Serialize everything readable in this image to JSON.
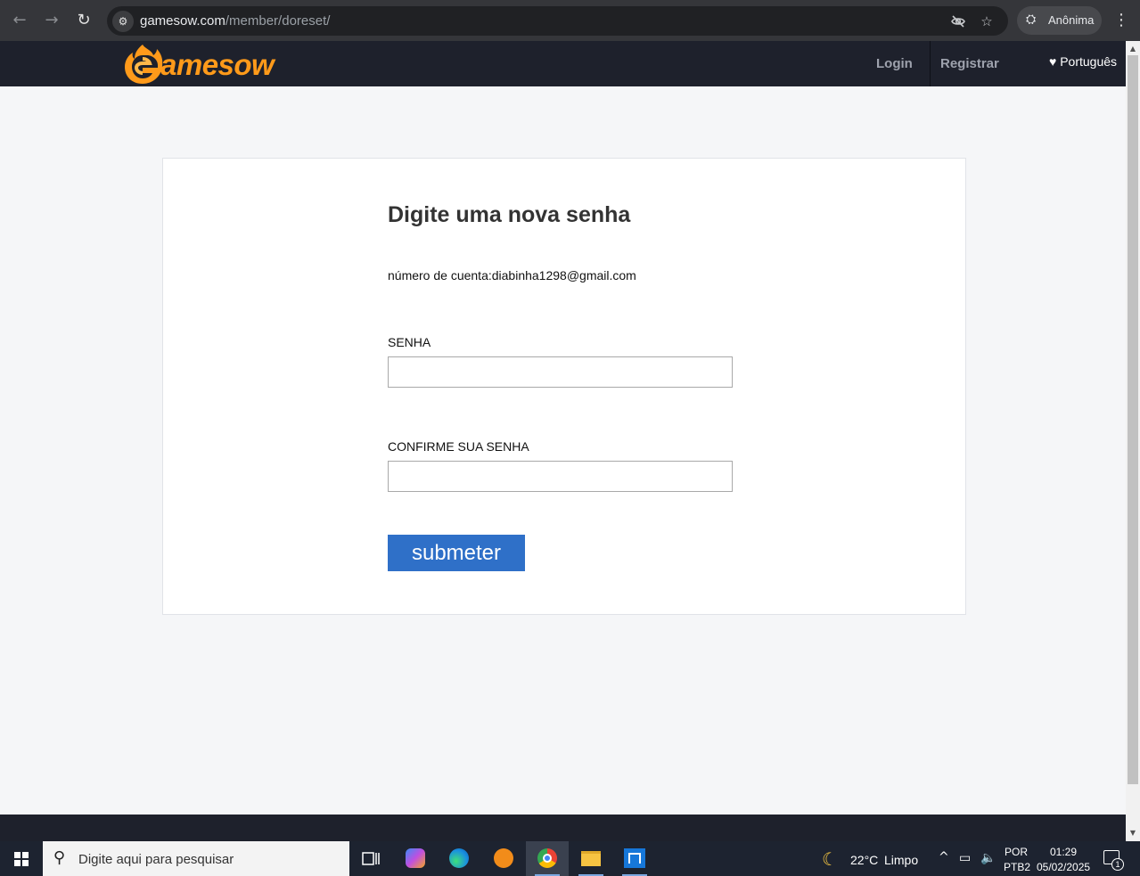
{
  "browser": {
    "url_host": "gamesow.com",
    "url_path": "/member/doreset/",
    "profile_label": "Anônima"
  },
  "header": {
    "logo_text": "amesow",
    "login": "Login",
    "register": "Registrar",
    "language": "♥ Português"
  },
  "form": {
    "title": "Digite uma nova senha",
    "account": "número de cuenta:diabinha1298@gmail.com",
    "password_label": "SENHA",
    "password_value": "",
    "confirm_label": "CONFIRME SUA SENHA",
    "confirm_value": "",
    "submit_label": "submeter"
  },
  "taskbar": {
    "search_placeholder": "Digite aqui para pesquisar",
    "weather_temp": "22°C",
    "weather_desc": "Limpo",
    "lang_line1": "POR",
    "lang_line2": "PTB2",
    "time": "01:29",
    "date": "05/02/2025",
    "notification_count": "1"
  },
  "colors": {
    "header_bg": "#1e212c",
    "submit_bg": "#2f70c8",
    "logo_orange": "#ff9a1a"
  }
}
